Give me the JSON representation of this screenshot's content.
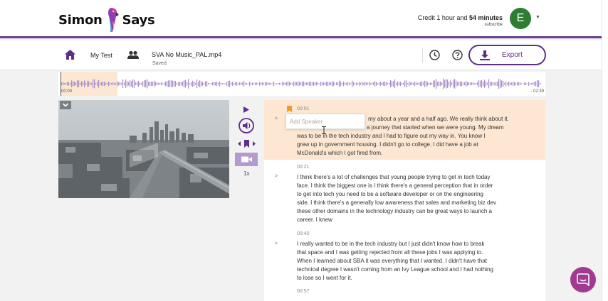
{
  "brand": {
    "word1": "Simon",
    "word2": "Says"
  },
  "account": {
    "credit_label": "Credit",
    "credit_hours": "1 hour and",
    "credit_minutes": "54 minutes",
    "subscribe": "subscribe",
    "avatar_initial": "E",
    "avatar_color": "#2e7d32"
  },
  "toolbar": {
    "project": "My Test",
    "filename": "SVA No Music_PAL.mp4",
    "status": "Saved",
    "export_label": "Export",
    "accent": "#5b2d8e"
  },
  "waveform": {
    "start_time": "00:00",
    "end_time": "- 02:39"
  },
  "player": {
    "speed": "1x"
  },
  "speaker_placeholder": "Add Speaker",
  "transcript": [
    {
      "time": "00:01",
      "lines": [
        "my about a year and a half ago. We really think about it.",
        "a journey that started when we were young. My dream",
        "was to be in the tech industry and I had to figure out my way in. You know I",
        "grew up in government housing. I didn't go to college. I did have a job at",
        "McDonald's which I got fired from."
      ]
    },
    {
      "time": "00:21",
      "lines": [
        "I think there's a lot of challenges that young people trying to get in tech today",
        "face. I think the biggest one is I think there's a general perception that in order",
        "to get into tech you need to be a software developer or on the engineering",
        "side. I think there's a generally low awareness that sales and marketing biz dev",
        "these other domains in the technology industry can be great ways to launch a",
        "career. I knew"
      ]
    },
    {
      "time": "00:40",
      "lines": [
        "I really wanted to be in the tech industry but I just didn't know how to break",
        "that space and I was getting rejected from all these jobs I was applying to.",
        "When I learned about SBA it was everything that I wanted. I didn't have that",
        "technical degree I wasn't coming from an Ivy League school and I had nothing",
        "to lose so I went for it."
      ]
    },
    {
      "time": "00:57",
      "lines": []
    }
  ],
  "chevron": ">"
}
